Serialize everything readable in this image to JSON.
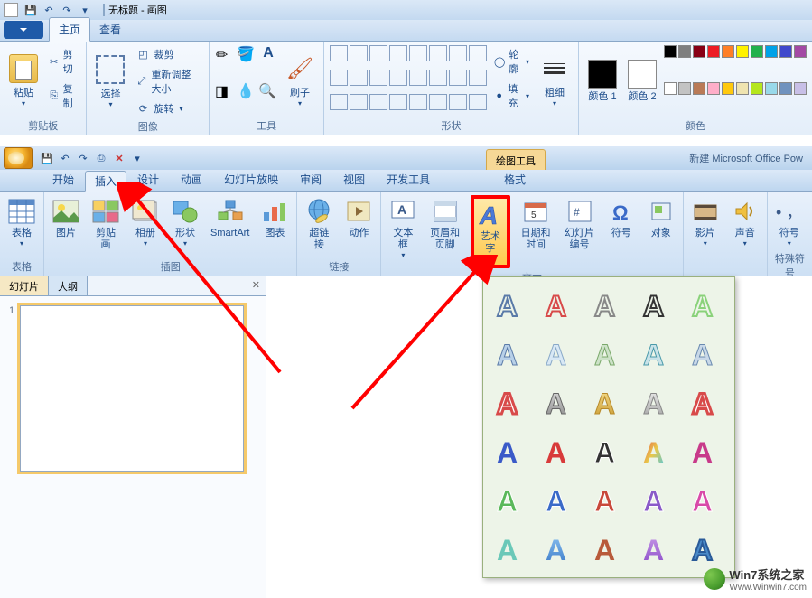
{
  "paint": {
    "title_doc": "无标题",
    "title_app": "画图",
    "tabs": {
      "home": "主页",
      "view": "查看"
    },
    "clipboard": {
      "paste": "粘贴",
      "cut": "剪切",
      "copy": "复制",
      "label": "剪贴板"
    },
    "image": {
      "select": "选择",
      "crop": "裁剪",
      "resize": "重新调整大小",
      "rotate": "旋转",
      "label": "图像"
    },
    "tools": {
      "brush": "刷子",
      "label": "工具"
    },
    "shapes": {
      "outline": "轮廓",
      "fill": "填充",
      "thick": "粗细",
      "label": "形状"
    },
    "colors": {
      "color1": "颜色 1",
      "color2": "颜色 2",
      "label": "颜色"
    },
    "palette": [
      "#000000",
      "#7f7f7f",
      "#880015",
      "#ed1c24",
      "#ff7f27",
      "#fff200",
      "#22b14c",
      "#00a2e8",
      "#3f48cc",
      "#a349a4",
      "#ffffff",
      "#c3c3c3",
      "#b97a57",
      "#ffaec9",
      "#ffc90e",
      "#efe4b0",
      "#b5e61d",
      "#99d9ea",
      "#7092be",
      "#c8bfe7"
    ]
  },
  "ppt": {
    "context_tool": "绘图工具",
    "doc_title": "新建 Microsoft Office Pow",
    "tabs": [
      "开始",
      "插入",
      "设计",
      "动画",
      "幻灯片放映",
      "审阅",
      "视图",
      "开发工具",
      "格式"
    ],
    "active_tab_index": 1,
    "ribbon": {
      "tables": {
        "table": "表格",
        "label": "表格"
      },
      "illustrations": {
        "picture": "图片",
        "clipart": "剪贴画",
        "album": "相册",
        "shape": "形状",
        "smartart": "SmartArt",
        "chart": "图表",
        "label": "插图"
      },
      "links": {
        "hyperlink": "超链接",
        "action": "动作",
        "label": "链接"
      },
      "text": {
        "textbox": "文本框",
        "header": "页眉和页脚",
        "wordart": "艺术字",
        "datetime": "日期和时间",
        "slidenum": "幻灯片编号",
        "symbol": "符号",
        "object": "对象",
        "label": "文本"
      },
      "media": {
        "movie": "影片",
        "sound": "声音",
        "label": ""
      },
      "symbols": {
        "symbol": "符号",
        "label": "特殊符号"
      }
    },
    "slidepanel": {
      "slides": "幻灯片",
      "outline": "大纲",
      "slide_num": "1"
    }
  },
  "wordart_styles": [
    {
      "fill": "none",
      "stroke": "#5a7aa8",
      "sw": 2
    },
    {
      "fill": "none",
      "stroke": "#d84a4a",
      "sw": 2
    },
    {
      "fill": "none",
      "stroke": "#888",
      "sw": 2
    },
    {
      "fill": "none",
      "stroke": "#333",
      "sw": 2
    },
    {
      "fill": "none",
      "stroke": "#8ad27a",
      "sw": 2
    },
    {
      "fill": "#b8d0e8",
      "stroke": "#5a7aa8",
      "sw": 1
    },
    {
      "fill": "#d8e8f5",
      "stroke": "#88a8c8",
      "sw": 1
    },
    {
      "fill": "#cde2c8",
      "stroke": "#7aa86a",
      "sw": 1
    },
    {
      "fill": "#c8e2e8",
      "stroke": "#4a9aaa",
      "sw": 1
    },
    {
      "fill": "#c8d8e8",
      "stroke": "#6a8ab0",
      "sw": 1
    },
    {
      "fill": "#fff",
      "stroke": "#d84a4a",
      "sw": 3
    },
    {
      "fill": "url(#g-gray)",
      "stroke": "#666",
      "sw": 1
    },
    {
      "fill": "url(#g-gold)",
      "stroke": "#b88a2a",
      "sw": 1
    },
    {
      "fill": "url(#g-silver)",
      "stroke": "#888",
      "sw": 1
    },
    {
      "fill": "#fff",
      "stroke": "#d84a4a",
      "sw": 3
    },
    {
      "fill": "#3a5ac8",
      "stroke": "none",
      "sw": 0
    },
    {
      "fill": "#d83a3a",
      "stroke": "none",
      "sw": 0
    },
    {
      "fill": "#333",
      "stroke": "#fff",
      "sw": 1
    },
    {
      "fill": "url(#g-rainbow)",
      "stroke": "none",
      "sw": 0
    },
    {
      "fill": "#c83a8a",
      "stroke": "none",
      "sw": 0
    },
    {
      "fill": "#5ab85a",
      "stroke": "#fff",
      "sw": 1
    },
    {
      "fill": "#3a6ac8",
      "stroke": "#fff",
      "sw": 1
    },
    {
      "fill": "#c8483a",
      "stroke": "#fff",
      "sw": 1
    },
    {
      "fill": "#8a5ac8",
      "stroke": "#fff",
      "sw": 1
    },
    {
      "fill": "#d84aa8",
      "stroke": "#fff",
      "sw": 1
    },
    {
      "fill": "#6ac8b8",
      "stroke": "none",
      "sw": 0
    },
    {
      "fill": "url(#g-bluegrad)",
      "stroke": "none",
      "sw": 0
    },
    {
      "fill": "#b85a3a",
      "stroke": "none",
      "sw": 0
    },
    {
      "fill": "url(#g-purple)",
      "stroke": "none",
      "sw": 0
    },
    {
      "fill": "#4a8ac8",
      "stroke": "#2a5a98",
      "sw": 2
    }
  ],
  "watermark": {
    "line1": "Win7系统之家",
    "line2": "Www.Winwin7.com"
  }
}
